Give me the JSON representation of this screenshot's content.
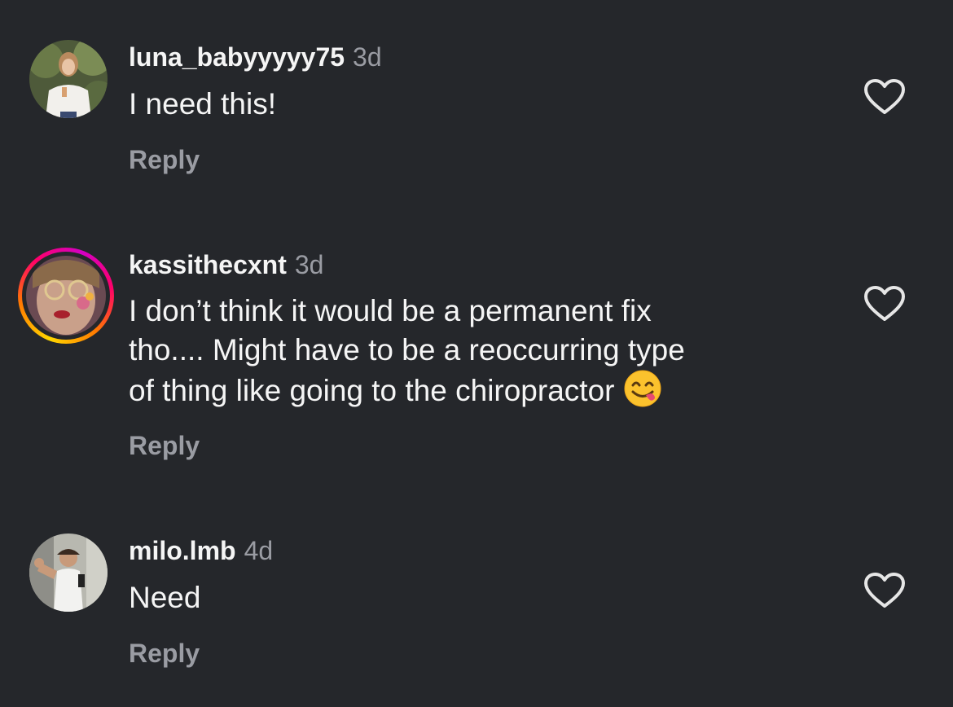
{
  "comments": [
    {
      "username": "luna_babyyyyy75",
      "age": "3d",
      "lines": [
        "I need this!"
      ],
      "reply_label": "Reply",
      "has_story_ring": false,
      "like_icon": "heart-outline-icon"
    },
    {
      "username": "kassithecxnt",
      "age": "3d",
      "lines": [
        "I don’t think it would be a permanent fix",
        "tho.... Might have to be a reoccurring type",
        "of thing like going to the chiropractor"
      ],
      "emoji": "face-savoring-food-emoji",
      "reply_label": "Reply",
      "has_story_ring": true,
      "like_icon": "heart-outline-icon"
    },
    {
      "username": "milo.lmb",
      "age": "4d",
      "lines": [
        "Need"
      ],
      "reply_label": "Reply",
      "has_story_ring": false,
      "like_icon": "heart-outline-icon"
    }
  ],
  "colors": {
    "background": "#25272b",
    "text": "#f5f5f5",
    "muted": "#9a9ca3"
  }
}
